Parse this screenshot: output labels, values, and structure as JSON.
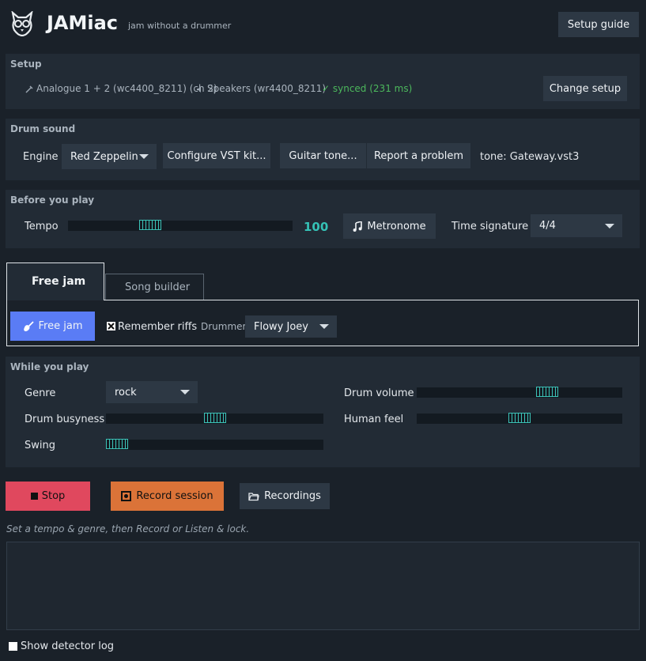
{
  "header": {
    "app_title": "JAMiac",
    "subtitle": "jam without a drummer",
    "setup_guide_label": "Setup guide",
    "logo_icon": "owl-logo-icon"
  },
  "setup": {
    "title": "Setup",
    "input_device": "Analogue 1 + 2 (wc4400_8211) (ch 2)",
    "input_icon": "guitar-cable-icon",
    "output_device": "Speakers (wr4400_8211)",
    "output_icon": "speaker-icon",
    "sync_status": "✓ synced (231 ms)",
    "sync_color": "#4cb85c",
    "change_label": "Change setup"
  },
  "drum_sound": {
    "title": "Drum sound",
    "engine_label": "Engine",
    "engine_value": "Red Zeppelin",
    "configure_label": "Configure VST kit...",
    "guitar_tone_label": "Guitar tone...",
    "report_label": "Report a problem",
    "tone_text": "tone: Gateway.vst3"
  },
  "before": {
    "title": "Before you play",
    "tempo_label": "Tempo",
    "tempo_value": "100",
    "tempo_fraction": 0.35,
    "tempo_color": "#35c2b6",
    "metronome_label": "Metronome",
    "metronome_icon": "music-note-icon",
    "timesig_label": "Time signature",
    "timesig_value": "4/4"
  },
  "tabs": {
    "free_jam": "Free jam",
    "song_builder": "Song builder"
  },
  "free_jam": {
    "button_label": "Free jam",
    "button_icon": "guitar-icon",
    "button_color": "#5a7cf5",
    "remember_label": "Remember riffs",
    "remember_checked": true,
    "drummer_label": "Drummer",
    "drummer_value": "Flowy Joey"
  },
  "while": {
    "title": "While you play",
    "genre_label": "Genre",
    "genre_value": "rock",
    "busyness_label": "Drum busyness",
    "busyness_fraction": 0.5,
    "swing_label": "Swing",
    "swing_fraction": 0.0,
    "volume_label": "Drum volume",
    "volume_fraction": 0.65,
    "human_label": "Human feel",
    "human_fraction": 0.5
  },
  "controls": {
    "stop_label": "Stop",
    "stop_color": "#e0485e",
    "record_label": "Record session",
    "record_color": "#db7338",
    "recordings_label": "Recordings",
    "recordings_icon": "folder-icon"
  },
  "hint": "Set a tempo & genre, then Record or Listen & lock.",
  "log": {
    "checkbox_label": "Show detector log",
    "checked": false
  }
}
